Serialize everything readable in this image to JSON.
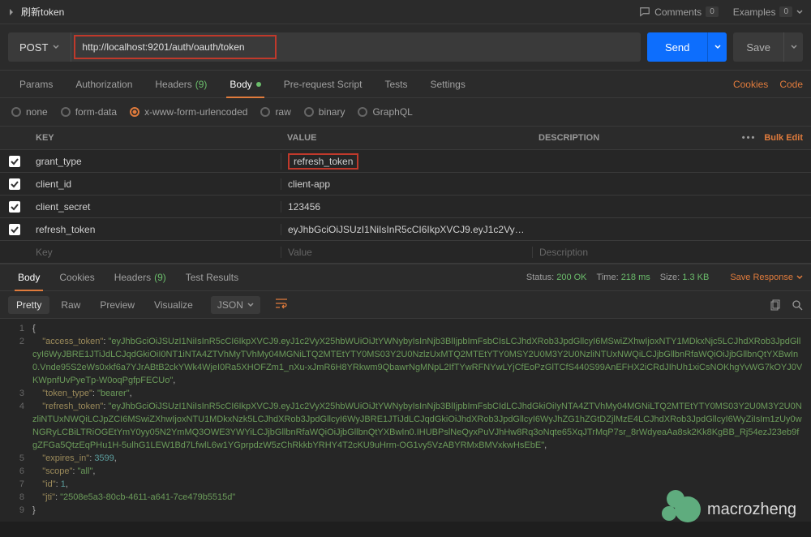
{
  "header": {
    "title": "刷新token",
    "comments": "Comments",
    "comments_count": "0",
    "examples": "Examples",
    "examples_count": "0"
  },
  "request": {
    "method": "POST",
    "url": "http://localhost:9201/auth/oauth/token",
    "send": "Send",
    "save": "Save"
  },
  "tabs": {
    "params": "Params",
    "auth": "Authorization",
    "headers": "Headers",
    "headers_count": "(9)",
    "body": "Body",
    "prerequest": "Pre-request Script",
    "tests": "Tests",
    "settings": "Settings",
    "cookies": "Cookies",
    "code": "Code"
  },
  "body_types": {
    "none": "none",
    "formdata": "form-data",
    "urlencoded": "x-www-form-urlencoded",
    "raw": "raw",
    "binary": "binary",
    "graphql": "GraphQL"
  },
  "params_table": {
    "head": {
      "key": "KEY",
      "value": "VALUE",
      "desc": "DESCRIPTION",
      "bulk": "Bulk Edit"
    },
    "rows": [
      {
        "key": "grant_type",
        "value": "refresh_token",
        "boxed": true
      },
      {
        "key": "client_id",
        "value": "client-app"
      },
      {
        "key": "client_secret",
        "value": "123456"
      },
      {
        "key": "refresh_token",
        "value": "eyJhbGciOiJSUzI1NiIsInR5cCI6IkpXVCJ9.eyJ1c2VyX25hbWU..."
      }
    ],
    "placeholder": {
      "key": "Key",
      "value": "Value",
      "desc": "Description"
    }
  },
  "response": {
    "tabs": {
      "body": "Body",
      "cookies": "Cookies",
      "headers": "Headers",
      "headers_count": "(9)",
      "tests": "Test Results"
    },
    "status_label": "Status:",
    "status": "200 OK",
    "time_label": "Time:",
    "time": "218 ms",
    "size_label": "Size:",
    "size": "1.3 KB",
    "save": "Save Response"
  },
  "view": {
    "pretty": "Pretty",
    "raw": "Raw",
    "preview": "Preview",
    "visualize": "Visualize",
    "format": "JSON"
  },
  "json": {
    "access_token": "eyJhbGciOiJSUzI1NiIsInR5cCI6IkpXVCJ9.eyJ1c2VyX25hbWUiOiJtYWNybyIsInNjb3BlIjpbImFsbCIsLCJhdXRob3JpdGllcyI6MSwiZXhwIjoxNTY1MDkxNjc5LCJhdXRob3JpdGllcyI6WyJBRE1JTiJdLCJqdGkiOiI0NT1iNTA4ZTVhMyTVhMy04MGNiLTQ2MTEtYTY0MS03Y2U0NzlzUxMTQ2MTEtYTY0MSY2U0M3Y2U0NzliNTUxNWQiLCJjbGllbnRfaWQiOiJjbGllbnQtYXBwIn0.Vnde95S2eWs0xkf6a7YJrABtB2ckYWk4WjeI0Ra5XHOFZm1_nXu-xJmR6H8YRkwm9QbawrNgMNpL2IfTYwRFNYwLYjCfEoPzGlTCfS440S99AnEFHX2iCRdJIhUh1xiCsNOKhgYvWG7kOYJ0VKWpnfUvPyeTp-W0oqPgfpFECUo",
    "token_type": "bearer",
    "refresh_token": "eyJhbGciOiJSUzI1NiIsInR5cCI6IkpXVCJ9.eyJ1c2VyX25hbWUiOiJtYWNybyIsInNjb3BlIjpbImFsbCIdLCJhdGkiOiIyNTA4ZTVhMy04MGNiLTQ2MTEtYTY0MS03Y2U0M3Y2U0NzliNTUxNWQiLCJpZCI6MSwiZXhwIjoxNTU1MDkxNzk5LCJhdXRob3JpdGllcyI6WyJBRE1JTiJdLCJqdGkiOiJhdXRob3JpdGllcyI6WyJhZG1hZGtDZjlMzE4LCJhdXRob3JpdGllcyI6WyZiIsIm1zUy0wNGRyLCBiLTRiOGEtYmY0yy05N2YmMQ3OWE3YWYiLCJjbGllbnRfaWQiOiJjbGllbnQtYXBwIn0.IHUBPslNeQyxPuVJhHw8Rq3oNqte65XqJTrMqP7sr_8rWdyeaAa8sk2Kk8KgBB_Rj54ezJ23eb9fgZFGa5QtzEqPHu1H-5ulhG1LEW1Bd7LfwlL6w1YGprpdzW5zChRkkbYRHY4T2cKU9uHrm-OG1vy5VzABYRMxBMVxkwHsEbE",
    "expires_in": 3599,
    "scope": "all",
    "id": 1,
    "jti": "2508e5a3-80cb-4611-a641-7ce479b5515d"
  },
  "watermark": "macrozheng"
}
